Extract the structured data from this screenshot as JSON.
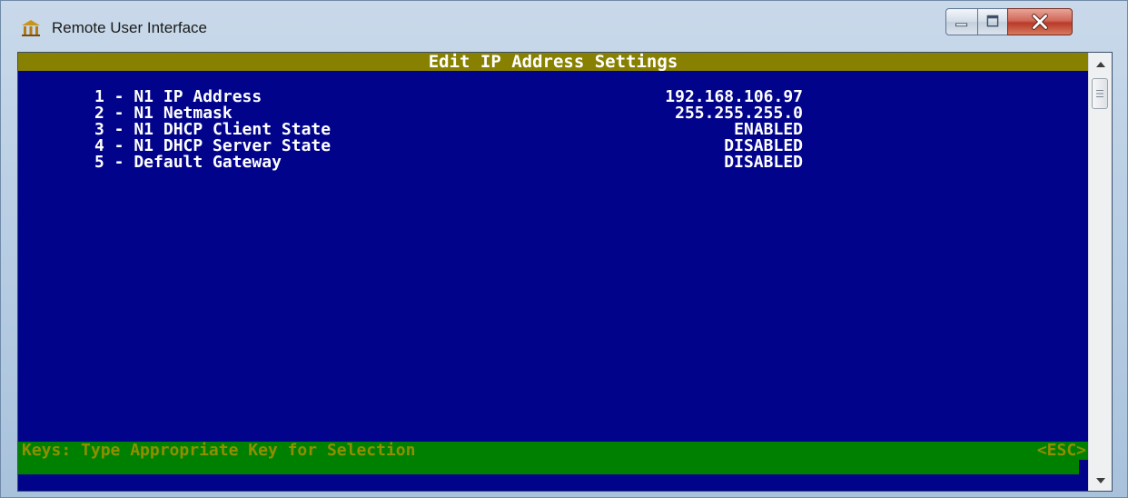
{
  "window": {
    "title": "Remote User Interface"
  },
  "colors": {
    "terminal_background": "#01048b",
    "header_bar": "#888000",
    "keys_bar": "#008000",
    "keys_text": "#8f8f00",
    "menu_text": "#ffffff"
  },
  "screen": {
    "header": "Edit IP Address Settings",
    "menu": [
      {
        "label": "1 - N1 IP Address",
        "value": "192.168.106.97"
      },
      {
        "label": "2 - N1 Netmask",
        "value": "255.255.255.0"
      },
      {
        "label": "3 - N1 DHCP Client State",
        "value": "ENABLED"
      },
      {
        "label": "4 - N1 DHCP Server State",
        "value": "DISABLED"
      },
      {
        "label": "5 - Default Gateway",
        "value": "DISABLED"
      }
    ],
    "keys_hint": "Keys: Type Appropriate Key for Selection",
    "escape_hint": "<ESC>"
  },
  "icons": {
    "app": "building-icon",
    "minimize": "minimize-icon",
    "maximize": "maximize-icon",
    "close": "close-icon",
    "scroll_up": "chevron-up-icon",
    "scroll_down": "chevron-down-icon"
  }
}
